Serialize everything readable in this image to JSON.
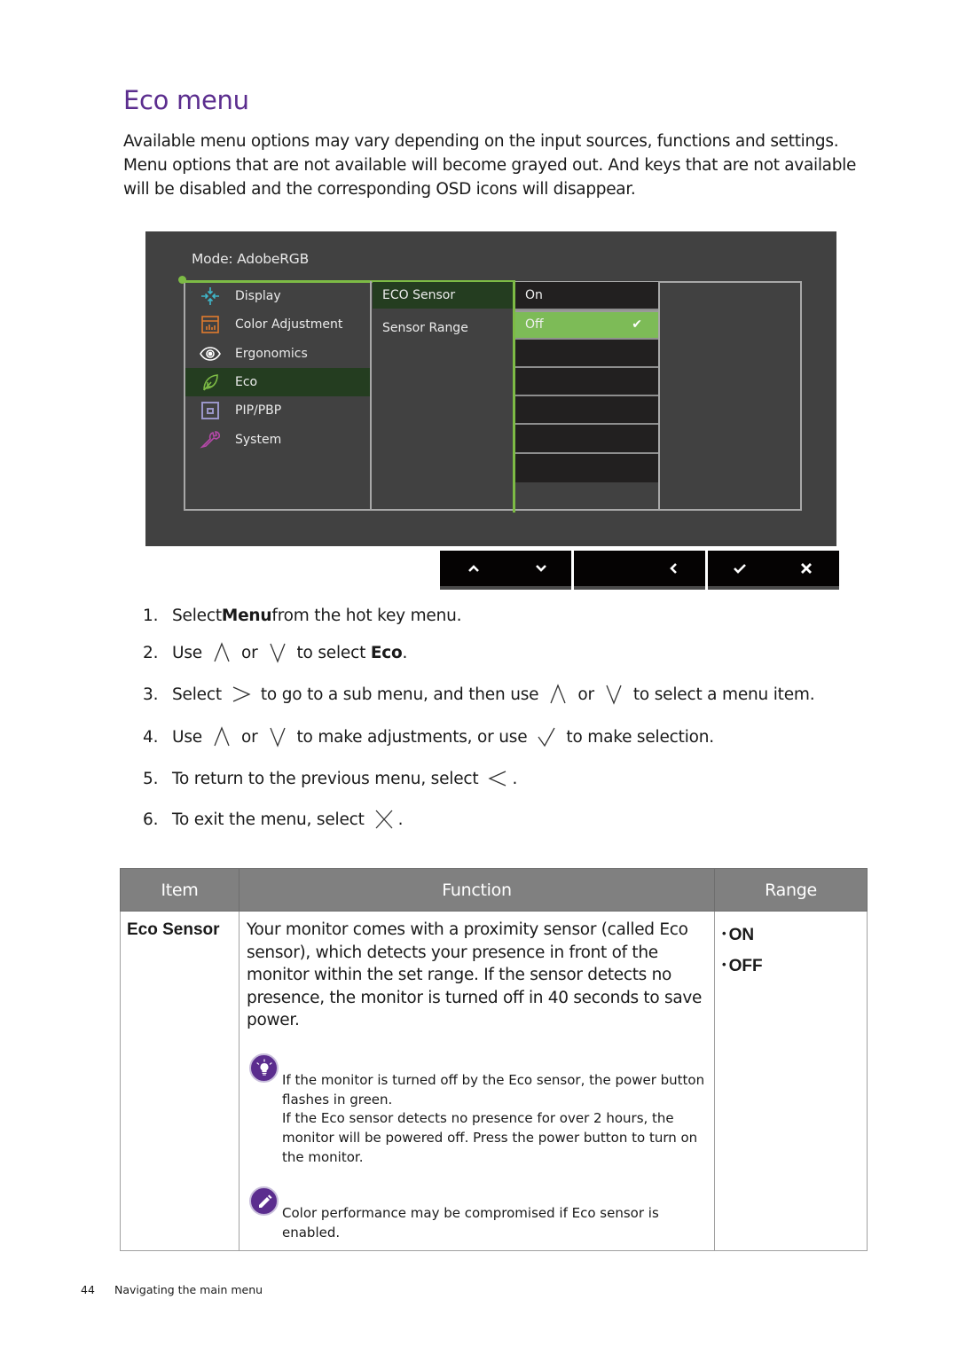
{
  "page": {
    "title": "Eco menu",
    "intro": "Available menu options may vary depending on the input sources, functions and settings. Menu options that are not available will become grayed out. And keys that are not available will be disabled and the corresponding OSD icons will disappear."
  },
  "osd": {
    "mode_label": "Mode: AdobeRGB",
    "accent_color": "#7dbb45",
    "menu_items": [
      {
        "label": "Display",
        "icon": "display-icon",
        "active": false
      },
      {
        "label": "Color Adjustment",
        "icon": "color-adjustment-icon",
        "active": false
      },
      {
        "label": "Ergonomics",
        "icon": "eye-icon",
        "active": false
      },
      {
        "label": "Eco",
        "icon": "leaf-icon",
        "active": true
      },
      {
        "label": "PIP/PBP",
        "icon": "pip-icon",
        "active": false
      },
      {
        "label": "System",
        "icon": "wrench-icon",
        "active": false
      }
    ],
    "sub_items": [
      {
        "label": "ECO Sensor",
        "active": true
      },
      {
        "label": "Sensor Range",
        "active": false
      }
    ],
    "options": [
      {
        "label": "On",
        "selected": false
      },
      {
        "label": "Off",
        "selected": true
      },
      {
        "label": "",
        "selected": false
      },
      {
        "label": "",
        "selected": false
      },
      {
        "label": "",
        "selected": false
      },
      {
        "label": "",
        "selected": false
      },
      {
        "label": "",
        "selected": false
      },
      {
        "label": "",
        "selected": false
      }
    ],
    "selected_check": "✔"
  },
  "hotkeys": [
    {
      "group": 1,
      "keys": [
        "up-icon",
        "down-icon"
      ]
    },
    {
      "group": 2,
      "keys": [
        "back-icon"
      ]
    },
    {
      "group": 3,
      "keys": [
        "check-icon",
        "close-icon"
      ]
    }
  ],
  "steps": [
    {
      "num": "1.",
      "parts": [
        "Select ",
        "Menu",
        " from the hot key menu."
      ]
    },
    {
      "num": "2.",
      "parts": [
        "Use",
        "or",
        "to select ",
        "Eco",
        "."
      ]
    },
    {
      "num": "3.",
      "parts": [
        "Select",
        "to go to a sub menu, and then use",
        "or",
        "to select a menu item."
      ]
    },
    {
      "num": "4.",
      "parts": [
        "Use",
        "or",
        "to make adjustments, or use",
        "to make selection."
      ]
    },
    {
      "num": "5.",
      "parts": [
        "To return to the previous menu, select",
        "."
      ]
    },
    {
      "num": "6.",
      "parts": [
        "To exit the menu, select",
        "."
      ]
    }
  ],
  "table": {
    "headers": [
      "Item",
      "Function",
      "Range"
    ],
    "rows": [
      {
        "item": "Eco Sensor",
        "function": "Your monitor comes with a proximity sensor (called Eco sensor), which detects your presence in front of the monitor within the set range. If the sensor detects no presence, the monitor is turned off in 40 seconds to save power.",
        "tip_note": [
          "If the monitor is turned off by the Eco sensor, the power button flashes in green.",
          "If the Eco sensor detects no presence for over 2 hours, the monitor will be powered off. Press the power button to turn on the monitor."
        ],
        "pencil_note": "Color performance may be compromised if Eco sensor is enabled.",
        "range": [
          "ON",
          "OFF"
        ]
      }
    ]
  },
  "footer": {
    "page_number": "44",
    "section": "Navigating the main menu"
  }
}
